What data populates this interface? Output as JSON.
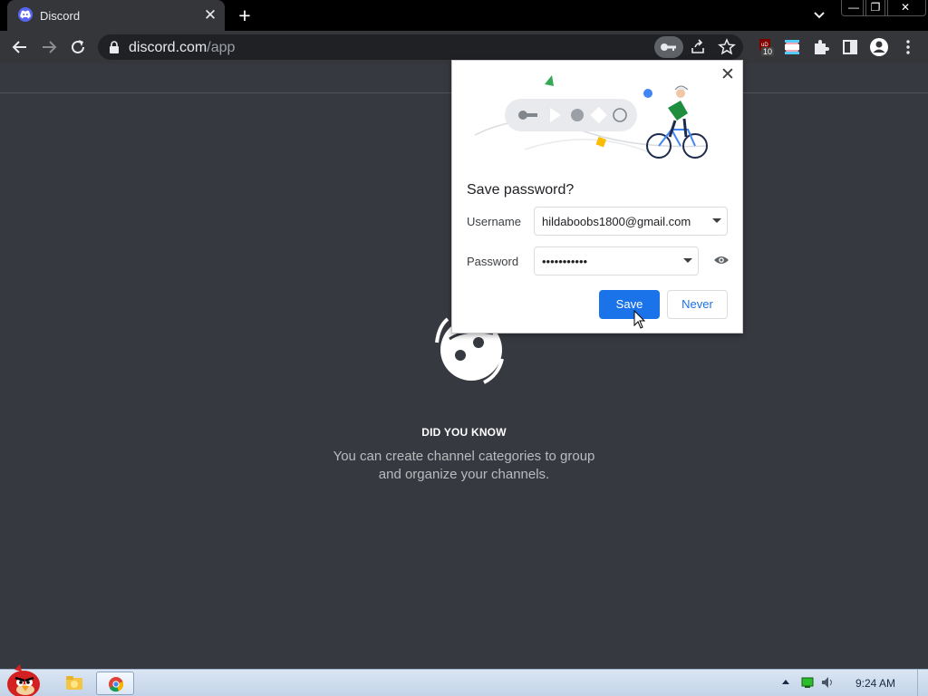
{
  "browser": {
    "tab": {
      "title": "Discord",
      "close_glyph": "✕"
    },
    "new_tab_glyph": "+",
    "url": {
      "host": "discord.com",
      "path": "/app"
    },
    "extension_badge": "10",
    "window_controls": {
      "minimize": "—",
      "restore": "❐",
      "close": "✕"
    }
  },
  "page": {
    "tip_heading": "DID YOU KNOW",
    "tip_text": "You can create channel categories to group and organize your channels."
  },
  "password_bubble": {
    "title": "Save password?",
    "close_glyph": "✕",
    "username_label": "Username",
    "username_value": "hildaboobs1800@gmail.com",
    "password_label": "Password",
    "password_value": "•••••••••••",
    "save_label": "Save",
    "never_label": "Never"
  },
  "taskbar": {
    "clock": "9:24 AM"
  },
  "colors": {
    "discord_bg": "#36393f",
    "chrome_dark": "#35363a",
    "accent_blue": "#1a73e8",
    "discord_blurple": "#5865f2"
  }
}
